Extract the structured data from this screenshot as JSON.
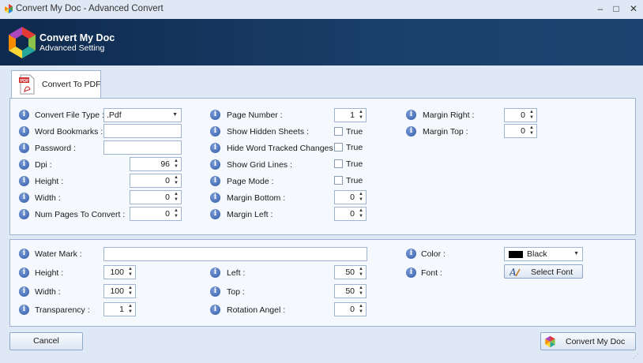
{
  "window": {
    "title": "Convert My Doc - Advanced Convert",
    "minimize": "–",
    "maximize": "□",
    "close": "✕"
  },
  "header": {
    "title": "Convert My Doc",
    "subtitle": "Advanced Setting"
  },
  "tab": {
    "label": "Convert To PDF",
    "icon": "pdf-file-icon"
  },
  "settings": {
    "file_type_label": "Convert File Type :",
    "file_type_value": ".Pdf",
    "bookmarks_label": "Word Bookmarks :",
    "bookmarks_value": "",
    "password_label": "Password :",
    "password_value": "",
    "dpi_label": "Dpi :",
    "dpi_value": "96",
    "height_label": "Height :",
    "height_value": "0",
    "width_label": "Width :",
    "width_value": "0",
    "numpages_label": "Num Pages To Convert :",
    "numpages_value": "0",
    "pagenumber_label": "Page Number :",
    "pagenumber_value": "1",
    "hiddensheets_label": "Show Hidden Sheets :",
    "hiddensheets_text": "True",
    "tracked_label": "Hide Word Tracked Changes :",
    "tracked_text": "True",
    "gridlines_label": "Show Grid Lines :",
    "gridlines_text": "True",
    "pagemode_label": "Page Mode :",
    "pagemode_text": "True",
    "marginbottom_label": "Margin Bottom :",
    "marginbottom_value": "0",
    "marginleft_label": "Margin Left :",
    "marginleft_value": "0",
    "marginright_label": "Margin Right :",
    "marginright_value": "0",
    "margintop_label": "Margin Top :",
    "margintop_value": "0"
  },
  "watermark": {
    "watermark_label": "Water Mark :",
    "watermark_value": "",
    "height_label": "Height :",
    "height_value": "100",
    "width_label": "Width :",
    "width_value": "100",
    "transparency_label": "Transparency :",
    "transparency_value": "1",
    "left_label": "Left :",
    "left_value": "50",
    "top_label": "Top :",
    "top_value": "50",
    "rotation_label": "Rotation Angel :",
    "rotation_value": "0",
    "color_label": "Color :",
    "color_value": "Black",
    "color_hex": "#000000",
    "font_label": "Font :",
    "font_button": "Select Font"
  },
  "footer": {
    "cancel": "Cancel",
    "convert": "Convert My Doc"
  },
  "info_glyph": "i",
  "colors": {
    "header_bg": "#0e2a4d",
    "window_bg": "#dfe8f5",
    "panel_border": "#9fb4d1",
    "info_icon": "#2f5aa8"
  }
}
